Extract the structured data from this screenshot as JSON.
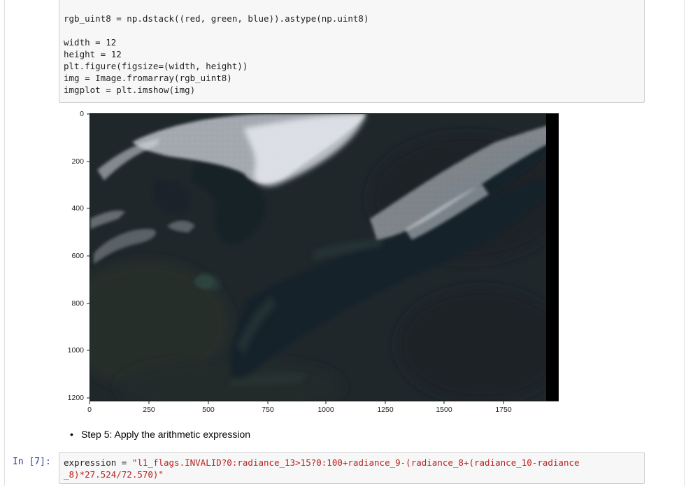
{
  "cell_top": {
    "lines": [
      "rgb_uint8 = np.dstack((red, green, blue)).astype(np.uint8)",
      "",
      "width = 12",
      "height = 12",
      "plt.figure(figsize=(width, height))",
      "img = Image.fromarray(rgb_uint8)",
      "imgplot = plt.imshow(img)"
    ]
  },
  "plot": {
    "y_ticks": [
      "0",
      "200",
      "400",
      "600",
      "800",
      "1000",
      "1200"
    ],
    "x_ticks": [
      "0",
      "250",
      "500",
      "750",
      "1000",
      "1250",
      "1500",
      "1750"
    ]
  },
  "markdown": {
    "step_text": "Step 5: Apply the arithmetic expression"
  },
  "cell_bottom": {
    "prompt": "In [7]:",
    "line1_var": "expression = ",
    "line1_str": "\"l1_flags.INVALID?0:radiance_13>15?0:100+radiance_9-(radiance_8+(radiance_10-radiance",
    "line2_str": "_8)*27.524/72.570)\""
  }
}
